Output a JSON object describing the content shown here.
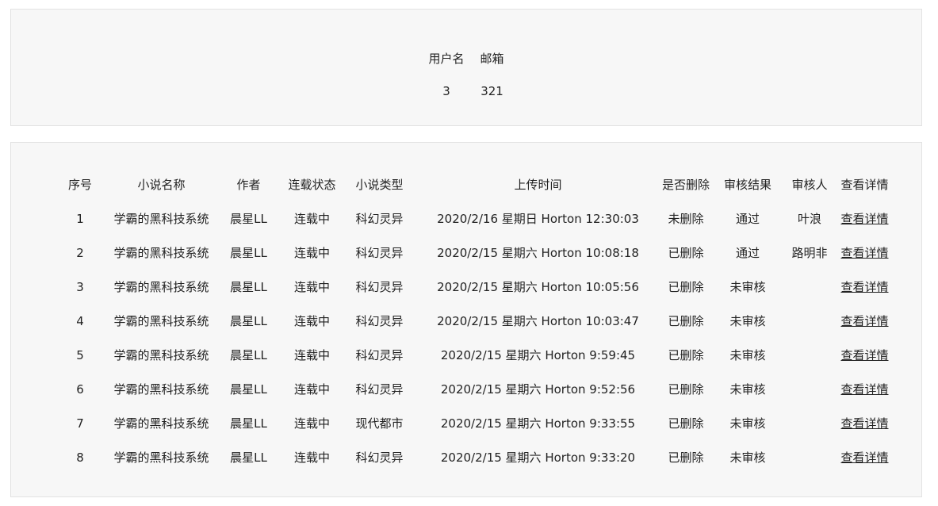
{
  "user_table": {
    "headers": {
      "username": "用户名",
      "email": "邮箱"
    },
    "row": {
      "username": "3",
      "email": "321"
    }
  },
  "novel_table": {
    "headers": {
      "index": "序号",
      "title": "小说名称",
      "author": "作者",
      "status": "连载状态",
      "genre": "小说类型",
      "uploaded": "上传时间",
      "deleted": "是否删除",
      "review_result": "审核结果",
      "reviewer": "审核人",
      "details": "查看详情"
    },
    "rows": [
      {
        "index": "1",
        "title": "学霸的黑科技系统",
        "author": "晨星LL",
        "status": "连载中",
        "genre": "科幻灵异",
        "uploaded": "2020/2/16 星期日 Horton 12:30:03",
        "deleted": "未删除",
        "review_result": "通过",
        "reviewer": "叶浪",
        "details": "查看详情"
      },
      {
        "index": "2",
        "title": "学霸的黑科技系统",
        "author": "晨星LL",
        "status": "连载中",
        "genre": "科幻灵异",
        "uploaded": "2020/2/15 星期六 Horton 10:08:18",
        "deleted": "已删除",
        "review_result": "通过",
        "reviewer": "路明非",
        "details": "查看详情"
      },
      {
        "index": "3",
        "title": "学霸的黑科技系统",
        "author": "晨星LL",
        "status": "连载中",
        "genre": "科幻灵异",
        "uploaded": "2020/2/15 星期六 Horton 10:05:56",
        "deleted": "已删除",
        "review_result": "未审核",
        "reviewer": "",
        "details": "查看详情"
      },
      {
        "index": "4",
        "title": "学霸的黑科技系统",
        "author": "晨星LL",
        "status": "连载中",
        "genre": "科幻灵异",
        "uploaded": "2020/2/15 星期六 Horton 10:03:47",
        "deleted": "已删除",
        "review_result": "未审核",
        "reviewer": "",
        "details": "查看详情"
      },
      {
        "index": "5",
        "title": "学霸的黑科技系统",
        "author": "晨星LL",
        "status": "连载中",
        "genre": "科幻灵异",
        "uploaded": "2020/2/15 星期六 Horton 9:59:45",
        "deleted": "已删除",
        "review_result": "未审核",
        "reviewer": "",
        "details": "查看详情"
      },
      {
        "index": "6",
        "title": "学霸的黑科技系统",
        "author": "晨星LL",
        "status": "连载中",
        "genre": "科幻灵异",
        "uploaded": "2020/2/15 星期六 Horton 9:52:56",
        "deleted": "已删除",
        "review_result": "未审核",
        "reviewer": "",
        "details": "查看详情"
      },
      {
        "index": "7",
        "title": "学霸的黑科技系统",
        "author": "晨星LL",
        "status": "连载中",
        "genre": "现代都市",
        "uploaded": "2020/2/15 星期六 Horton 9:33:55",
        "deleted": "已删除",
        "review_result": "未审核",
        "reviewer": "",
        "details": "查看详情"
      },
      {
        "index": "8",
        "title": "学霸的黑科技系统",
        "author": "晨星LL",
        "status": "连载中",
        "genre": "科幻灵异",
        "uploaded": "2020/2/15 星期六 Horton 9:33:20",
        "deleted": "已删除",
        "review_result": "未审核",
        "reviewer": "",
        "details": "查看详情"
      }
    ]
  }
}
